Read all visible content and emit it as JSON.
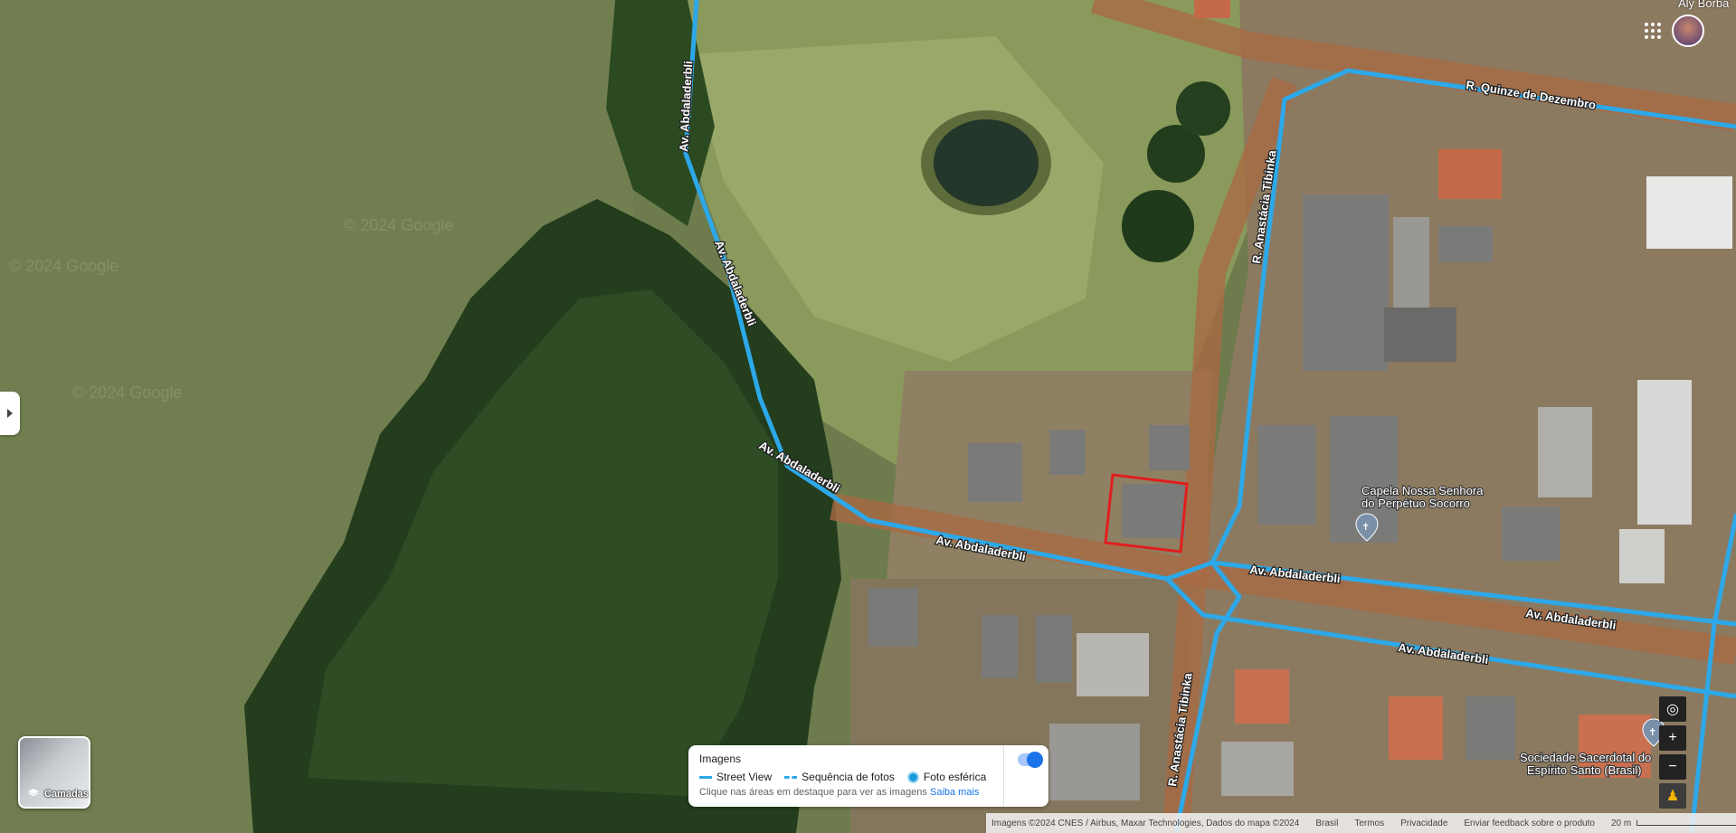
{
  "map": {
    "streets": {
      "abdaladerbli": "Av. Abdaladerbli",
      "quinze": "R. Quinze de Dezembro",
      "anastacia": "R. Anastácia Tibinka"
    },
    "pois": {
      "capela": [
        "Capela Nossa Senhora",
        "do Perpétuo Socorro"
      ],
      "sociedade": [
        "Sociedade Sacerdotal do",
        "Espírito Santo (Brasil)"
      ]
    },
    "watermarks": [
      "© 2024 Google",
      "© 2024 Google",
      "© 2024 Google"
    ]
  },
  "layers": {
    "label": "Camadas",
    "icon": "layers-icon"
  },
  "legend": {
    "title": "Imagens",
    "items": [
      "Street View",
      "Sequência de fotos",
      "Foto esférica"
    ],
    "hint": "Clique nas áreas em destaque para ver as imagens",
    "hint_link": "Saiba mais"
  },
  "user": {
    "name": "Aly Borba"
  },
  "footer": {
    "attribution": "Imagens ©2024 CNES / Airbus, Maxar Technologies, Dados do mapa ©2024",
    "links": [
      "Brasil",
      "Termos",
      "Privacidade",
      "Enviar feedback sobre o produto"
    ],
    "scale": "20 m"
  },
  "colors": {
    "road": "#2da8e8",
    "highlight": "#e01e1e"
  }
}
